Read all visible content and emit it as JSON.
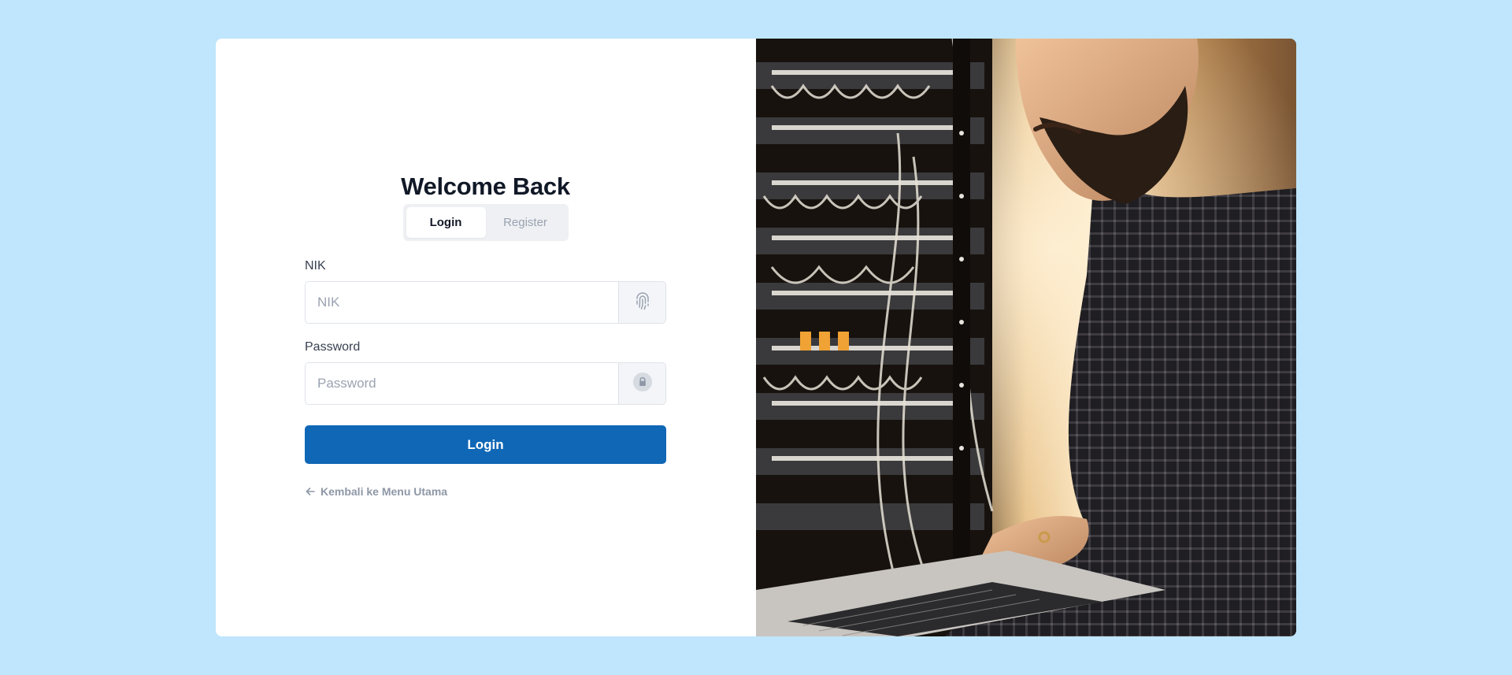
{
  "header": {
    "title": "Welcome Back"
  },
  "tabs": [
    {
      "label": "Login",
      "active": true
    },
    {
      "label": "Register",
      "active": false
    }
  ],
  "form": {
    "nik": {
      "label": "NIK",
      "placeholder": "NIK",
      "value": "",
      "icon": "fingerprint-icon"
    },
    "password": {
      "label": "Password",
      "placeholder": "Password",
      "value": "",
      "icon": "lock-icon"
    },
    "submit_label": "Login"
  },
  "back_link": {
    "label": "Kembali ke Menu Utama",
    "icon": "arrow-left-icon"
  },
  "hero_image": {
    "subject": "photo-man-with-laptop-in-server-room"
  },
  "colors": {
    "page_background": "#bfe6fc",
    "primary": "#0f67b6",
    "heading": "#111827",
    "muted": "#9aa3b1"
  }
}
